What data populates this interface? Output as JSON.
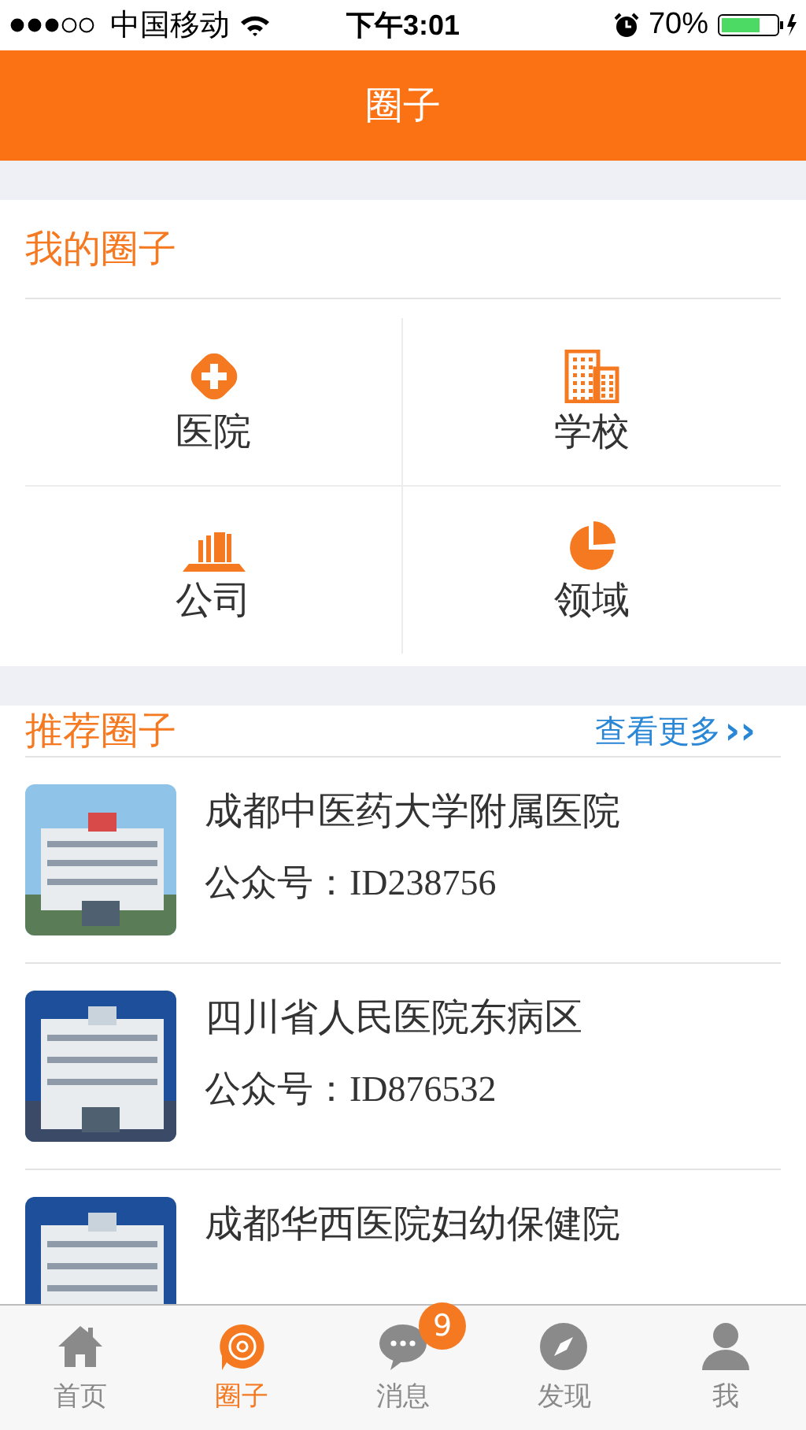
{
  "status_bar": {
    "carrier": "中国移动",
    "time": "下午3:01",
    "battery": "70%"
  },
  "header": {
    "title": "圈子"
  },
  "my_circles": {
    "title": "我的圈子",
    "items": [
      {
        "kind": "hospital",
        "label": "医院"
      },
      {
        "kind": "school",
        "label": "学校"
      },
      {
        "kind": "company",
        "label": "公司"
      },
      {
        "kind": "field",
        "label": "领域"
      }
    ]
  },
  "recommended": {
    "title": "推荐圈子",
    "more": "查看更多",
    "more_icon": "››",
    "items": [
      {
        "name": "成都中医药大学附属医院",
        "account": "公众号：ID238756",
        "kind": "picture"
      },
      {
        "name": "四川省人民医院东病区",
        "account": "公众号：ID876532",
        "kind": "picture"
      },
      {
        "name": "成都华西医院妇幼保健院",
        "kind": "picture"
      }
    ]
  },
  "tab_bar": [
    {
      "kind": "home",
      "label": "首页",
      "selected": false
    },
    {
      "kind": "circle",
      "label": "圈子",
      "selected": true
    },
    {
      "kind": "message",
      "label": "消息",
      "selected": false,
      "badge": "9"
    },
    {
      "kind": "discover",
      "label": "发现",
      "selected": false
    },
    {
      "kind": "me",
      "label": "我",
      "selected": false
    }
  ]
}
